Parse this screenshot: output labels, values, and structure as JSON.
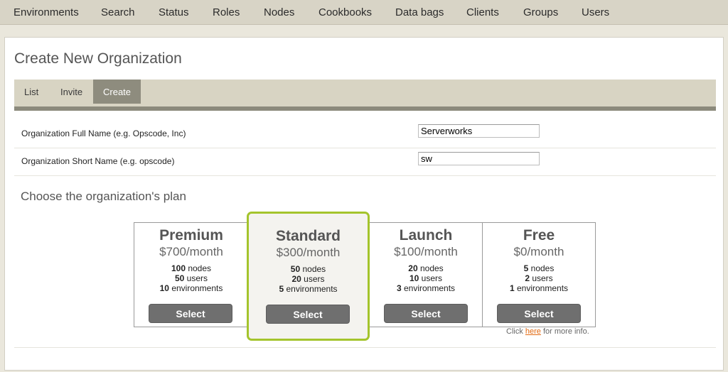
{
  "nav": {
    "items": [
      "Environments",
      "Search",
      "Status",
      "Roles",
      "Nodes",
      "Cookbooks",
      "Data bags",
      "Clients",
      "Groups",
      "Users"
    ]
  },
  "page": {
    "title": "Create New Organization"
  },
  "tabs": [
    {
      "label": "List",
      "active": false
    },
    {
      "label": "Invite",
      "active": false
    },
    {
      "label": "Create",
      "active": true
    }
  ],
  "form": {
    "full_name": {
      "label": "Organization Full Name (e.g. Opscode, Inc)",
      "value": "Serverworks"
    },
    "short_name": {
      "label": "Organization Short Name (e.g. opscode)",
      "value": "sw"
    }
  },
  "plans_heading": "Choose the organization's plan",
  "plans": [
    {
      "name": "Premium",
      "price": "$700/month",
      "nodes": "100",
      "users": "50",
      "environments": "10",
      "button": "Select"
    },
    {
      "name": "Standard",
      "price": "$300/month",
      "nodes": "50",
      "users": "20",
      "environments": "5",
      "button": "Select"
    },
    {
      "name": "Launch",
      "price": "$100/month",
      "nodes": "20",
      "users": "10",
      "environments": "3",
      "button": "Select"
    },
    {
      "name": "Free",
      "price": "$0/month",
      "nodes": "5",
      "users": "2",
      "environments": "1",
      "button": "Select"
    }
  ],
  "feature_labels": {
    "nodes": " nodes",
    "users": " users",
    "environments": " environments"
  },
  "more_info": {
    "prefix": "Click ",
    "link": "here",
    "suffix": " for more info."
  },
  "colors": {
    "highlight_border": "#a4c42c",
    "link": "#e26a12",
    "tab_active": "#8e8c7e",
    "button": "#6f6f6f"
  }
}
